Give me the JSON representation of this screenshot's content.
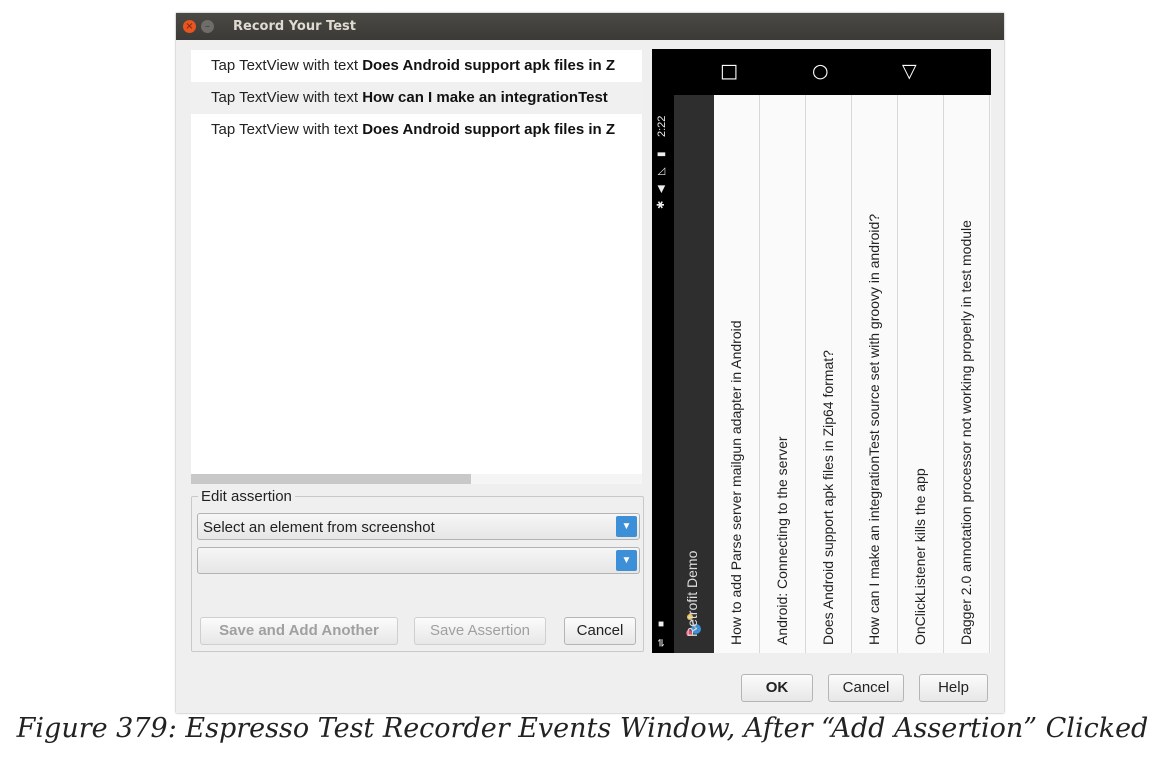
{
  "window": {
    "title": "Record Your Test"
  },
  "events": [
    {
      "prefix": "Tap TextView with text ",
      "bold": "Does Android support apk files in Z"
    },
    {
      "prefix": "Tap TextView with text ",
      "bold": "How can I make an integrationTest"
    },
    {
      "prefix": "Tap TextView with text ",
      "bold": "Does Android support apk files in Z"
    }
  ],
  "assertion": {
    "legend": "Edit assertion",
    "element_select": "Select an element from screenshot",
    "assertion_select": "",
    "save_add_another": "Save and Add Another",
    "save_assertion": "Save Assertion",
    "cancel": "Cancel"
  },
  "device": {
    "status_time": "2:22",
    "app_title": "Retrofit Demo",
    "questions": [
      "How to add Parse server mailgun adapter in Android",
      "Android: Connecting to the server",
      "Does Android support apk files in Zip64 format?",
      "How can I make an integrationTest source set with groovy in android?",
      "OnClickListener kills the app",
      "Dagger 2.0 annotation processor not working properly in test module"
    ]
  },
  "dialog_buttons": {
    "ok": "OK",
    "cancel": "Cancel",
    "help": "Help"
  },
  "caption": "Figure 379: Espresso Test Recorder Events Window, After “Add Assertion” Clicked"
}
